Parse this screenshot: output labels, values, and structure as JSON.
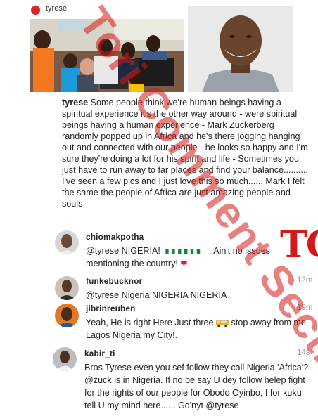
{
  "post": {
    "author": "tyrese",
    "caption_user": "tyrese",
    "caption_text": "Some people think we're human beings having a spiritual experience it's the other way around - were spiritual beings having a human experience - Mark Zuckerberg randomly popped up in Africa and he's there jogging hanging out and connected with our people - he looks so happy and I'm sure they're doing a lot for his spirit and life - Sometimes you just have to run away to far places and find your balance.......... I've seen a few pics and I just love this so much...... Mark I felt the same the people of Africa are just amazing people and souls -"
  },
  "comments": [
    {
      "user": "chiomakpotha",
      "time": "",
      "mention": "@tyrese",
      "text_before": "NIGERIA!",
      "text_after": ". Ain't no issues mentioning the country!"
    },
    {
      "user": "funkebucknor",
      "time": "12m",
      "mention": "@tyrese",
      "text": "Nigeria NIGERIA NIGERIA"
    },
    {
      "user": "jibrinreuben",
      "time": "19m",
      "text_before": "Yeah, He is right Here Just three",
      "text_after": "stop away from me. Lagos Nigeria my City!."
    },
    {
      "user": "kabir_ti",
      "time": "14s",
      "text_before": "Bros Tyrese even you sef follow they call Nigeria 'Africa'?",
      "mention": "@zuck",
      "text_mid": "is in Nigeria. If no be say U dey follow helep fight for the rights of our people for Obodo Oyinbo, I for kuku tell U my mind here...... Gd'nyt",
      "mention_end": "@tyrese"
    }
  ],
  "watermark": {
    "text": "Tori Comment Section",
    "logo": "TC"
  },
  "colors": {
    "accent_red": "#d51818",
    "flag_green": "#0a8a3c"
  },
  "icons": {
    "profile": "red-circle-avatar",
    "bus": "bus-emoji",
    "heart": "heart-emoji",
    "flag": "nigeria-flag-emoji"
  }
}
